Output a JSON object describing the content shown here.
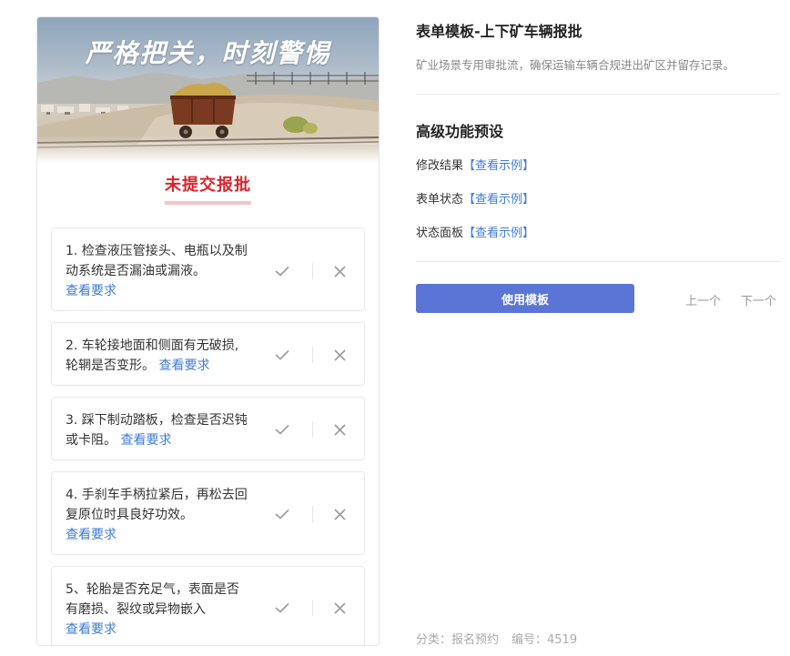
{
  "preview": {
    "banner_title": "严格把关，时刻警惕",
    "status_title": "未提交报批",
    "items": [
      {
        "text": "1. 检查液压管接头、电瓶以及制动系统是否漏油或漏液。",
        "link": "查看要求"
      },
      {
        "text": "2. 车轮接地面和侧面有无破损,轮辋是否变形。",
        "link": "查看要求"
      },
      {
        "text": "3. 踩下制动踏板，检查是否迟钝或卡阻。",
        "link": "查看要求"
      },
      {
        "text": "4. 手刹车手柄拉紧后，再松去回复原位时具良好功效。",
        "link": "查看要求"
      },
      {
        "text": "5、轮胎是否充足气，表面是否有磨损、裂纹或异物嵌入",
        "link": "查看要求"
      }
    ],
    "icons": {
      "confirm": "check-icon",
      "reject": "close-icon"
    }
  },
  "template": {
    "title": "表单模板-上下矿车辆报批",
    "description": "矿业场景专用审批流，确保运输车辆合规进出矿区并留存记录。"
  },
  "advanced": {
    "title": "高级功能预设",
    "features": [
      {
        "label": "修改结果",
        "link": "【查看示例】"
      },
      {
        "label": "表单状态",
        "link": "【查看示例】"
      },
      {
        "label": "状态面板",
        "link": "【查看示例】"
      }
    ]
  },
  "actions": {
    "use_template": "使用模板",
    "prev": "上一个",
    "next": "下一个"
  },
  "footer": {
    "category": "分类：报名预约",
    "number": "编号：4519"
  },
  "colors": {
    "accent": "#5b75d6",
    "link": "#3f7bd8",
    "alert": "#d9252c"
  }
}
